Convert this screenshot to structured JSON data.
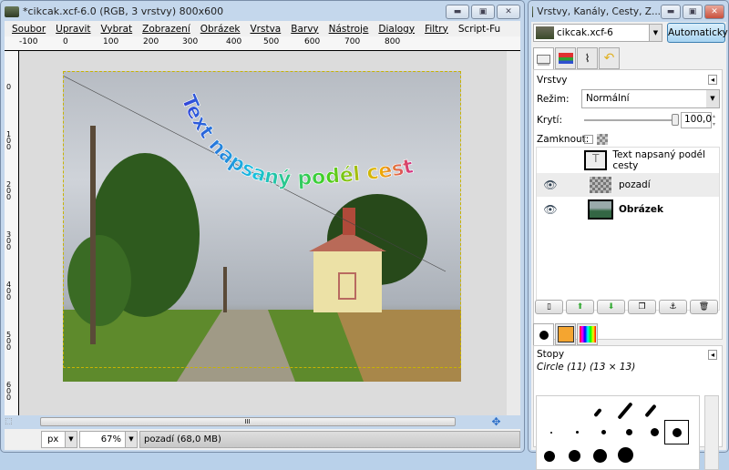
{
  "main_window": {
    "title": "*cikcak.xcf-6.0 (RGB, 3 vrstvy) 800x600",
    "menu": [
      "Soubor",
      "Upravit",
      "Vybrat",
      "Zobrazení",
      "Obrázek",
      "Vrstva",
      "Barvy",
      "Nástroje",
      "Dialogy",
      "Filtry",
      "Script-Fu"
    ],
    "hruler": [
      "-100",
      "0",
      "100",
      "200",
      "300",
      "400",
      "500",
      "600",
      "700",
      "800"
    ],
    "vruler": [
      "0",
      "100",
      "200",
      "300",
      "400",
      "500",
      "600"
    ],
    "canvas_text": "Text napsaný podél cesty",
    "status": {
      "unit": "px",
      "zoom": "67%",
      "message": "pozadí (68,0 MB)"
    },
    "hscroll_grip": "III"
  },
  "dock": {
    "title": "Vrstvy, Kanály, Cesty, Z...",
    "image_select": "cikcak.xcf-6",
    "auto_button": "Automaticky",
    "layers_panel": {
      "title": "Vrstvy",
      "mode_label": "Režim:",
      "mode_value": "Normální",
      "opacity_label": "Krytí:",
      "opacity_value": "100,0",
      "opacity": 100,
      "lock_label": "Zamknout:",
      "layers": [
        {
          "name": "Text napsaný podél cesty",
          "visible": false,
          "bold": false
        },
        {
          "name": "pozadí",
          "visible": true,
          "bold": false
        },
        {
          "name": "Obrázek",
          "visible": true,
          "bold": true
        }
      ]
    },
    "brushes_panel": {
      "title": "Stopy",
      "current": "Circle (11) (13 × 13)"
    }
  }
}
